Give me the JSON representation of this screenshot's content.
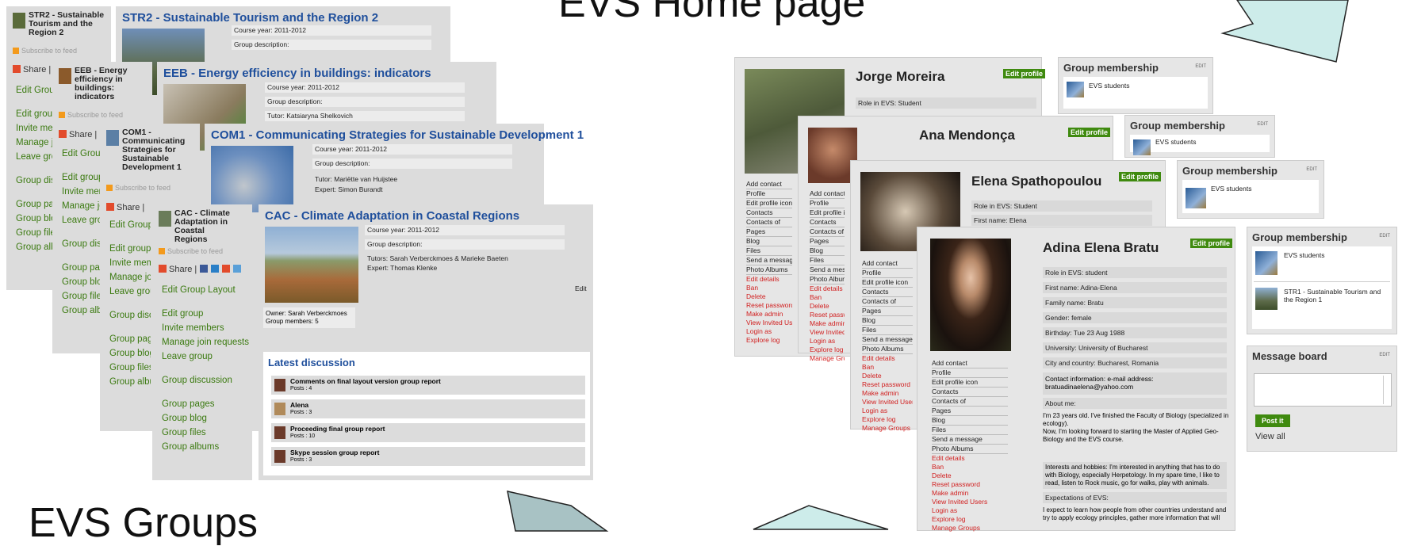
{
  "slide": {
    "home_title": "EVS Home page",
    "groups_title": "EVS Groups"
  },
  "groups": [
    {
      "short_name": "STR2 - Sustainable Tourism and the Region 2",
      "title": "STR2 - Sustainable Tourism and the Region 2",
      "subscribe": "Subscribe to feed",
      "share": "Share |",
      "menu": [
        "Edit Group Layout",
        "Edit group",
        "Invite members",
        "Manage join requests",
        "Leave group",
        "Group discussion",
        "Group pages",
        "Group blog",
        "Group files",
        "Group albums"
      ],
      "course_year": "Course year: 2011-2012",
      "group_description": "Group description:"
    },
    {
      "short_name": "EEB - Energy efficiency in buildings: indicators",
      "title": "EEB - Energy efficiency in buildings: indicators",
      "subscribe": "Subscribe to feed",
      "share": "Share |",
      "menu": [
        "Edit Group Layout",
        "Edit group",
        "Invite members",
        "Manage join requests",
        "Leave group",
        "Group discussion",
        "Group pages",
        "Group blog",
        "Group files",
        "Group albums"
      ],
      "course_year": "Course year: 2011-2012",
      "group_description": "Group description:",
      "tutor": "Tutor: Katsiaryna Shelkovich"
    },
    {
      "short_name": "COM1 - Communicating Strategies for Sustainable Development 1",
      "title": "COM1 - Communicating Strategies for Sustainable Development 1",
      "subscribe": "Subscribe to feed",
      "share": "Share |",
      "menu": [
        "Edit Group Layout",
        "Edit group",
        "Invite members",
        "Manage join requests",
        "Leave group",
        "Group discussion",
        "Group pages",
        "Group blog",
        "Group files",
        "Group albums"
      ],
      "course_year": "Course year: 2011-2012",
      "group_description": "Group description:",
      "tutor": "Tutor: Mariëtte van Huijstee",
      "expert": "Expert: Simon Burandt"
    },
    {
      "short_name": "CAC - Climate Adaptation in Coastal Regions",
      "title": "CAC - Climate Adaptation in Coastal Regions",
      "subscribe": "Subscribe to feed",
      "share": "Share |",
      "menu": [
        "Edit Group Layout",
        "Edit group",
        "Invite members",
        "Manage join requests",
        "Leave group",
        "Group discussion",
        "Group pages",
        "Group blog",
        "Group files",
        "Group albums"
      ],
      "course_year": "Course year: 2011-2012",
      "group_description": "Group description:",
      "tutors": "Tutors: Sarah Verberckmoes & Marieke Baeten",
      "expert": "Expert: Thomas Klenke",
      "edit": "Edit",
      "owner": "Owner: Sarah Verberckmoes",
      "members": "Group members: 5",
      "latest_discussion": "Latest discussion",
      "discussions": [
        {
          "title": "Comments on final layout version group report",
          "posts": "Posts : 4"
        },
        {
          "title": "Alena",
          "posts": "Posts : 3"
        },
        {
          "title": "Proceeding final group report",
          "posts": "Posts : 10"
        },
        {
          "title": "Skype session group report",
          "posts": "Posts : 3"
        }
      ]
    }
  ],
  "profiles": [
    {
      "name": "Jorge Moreira",
      "edit": "Edit profile",
      "role": "Role in EVS: Student"
    },
    {
      "name": "Ana Mendonça",
      "edit": "Edit profile"
    },
    {
      "name": "Elena Spathopoulou",
      "edit": "Edit profile",
      "role": "Role in EVS: Student",
      "first": "First name: Elena"
    },
    {
      "name": "Adina Elena Bratu",
      "edit": "Edit profile",
      "fields": [
        "Role in EVS: student",
        "First name: Adina-Elena",
        "Family name: Bratu",
        "Gender: female",
        "Birthday: Tue 23 Aug 1988",
        "University: University of Bucharest",
        "City and country: Bucharest, Romania"
      ],
      "contact_1": "Contact information: e-mail address:",
      "contact_2": "bratuadinaelena@yahoo.com",
      "about_label": "About me:",
      "about_1": "I'm 23 years old. I've finished the Faculty of Biology (specialized in",
      "about_2": "ecology).",
      "about_3": "Now, I'm looking forward to starting the Master of Applied Geo-",
      "about_4": "Biology and the EVS course.",
      "interests_1": "Interests and hobbies: I'm interested in anything that has to do",
      "interests_2": "with Biology, especially Herpetology. In my spare time, I like to",
      "interests_3": "read, listen to Rock music, go for walks, play with animals.",
      "expect_label": "Expectations of EVS:",
      "expect_1": "I expect to learn how people from other countries understand and",
      "expect_2": "try to apply ecology principles, gather more information that will"
    }
  ],
  "profile_menu": {
    "normal": [
      "Add contact",
      "Profile",
      "Edit profile icon",
      "Contacts",
      "Contacts of",
      "Pages",
      "Blog",
      "Files",
      "Send a message",
      "Photo Albums"
    ],
    "admin": [
      "Edit details",
      "Ban",
      "Delete",
      "Reset password",
      "Make admin",
      "View Invited Users",
      "Login as",
      "Explore log",
      "Manage Groups"
    ]
  },
  "group_membership": {
    "title": "Group membership",
    "edit": "EDIT",
    "items": [
      "EVS students",
      "STR1 - Sustainable Tourism and the Region 1"
    ]
  },
  "message_board": {
    "title": "Message board",
    "edit": "EDIT",
    "post_button": "Post it",
    "view_all": "View all"
  },
  "colors": {
    "link_green": "#3b7a10",
    "title_blue": "#1f4f9c",
    "admin_red": "#d12020",
    "edit_green": "#3f8a0f",
    "arrow_fill": "#cdecea",
    "arrow_fill_dark": "#a8c2c4"
  }
}
